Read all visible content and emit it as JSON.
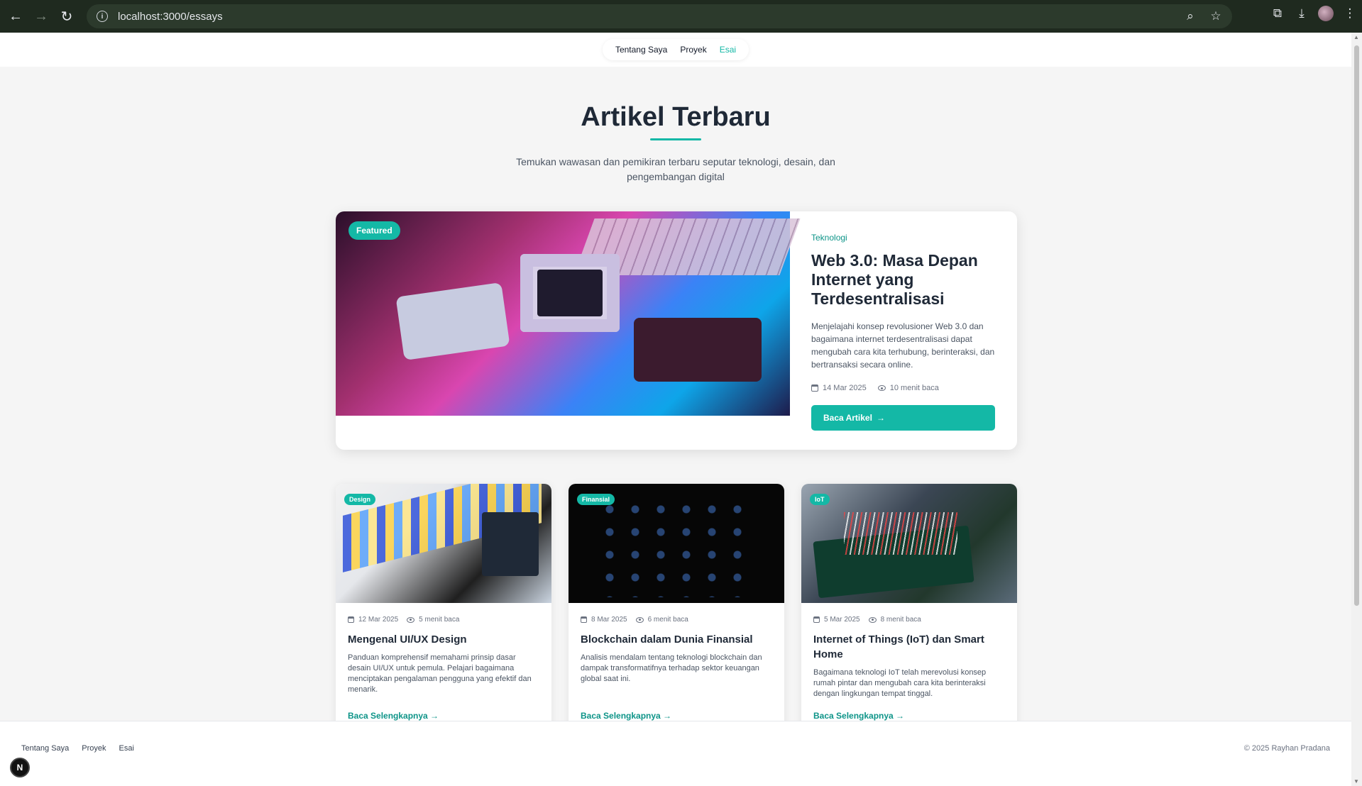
{
  "browser": {
    "url": "localhost:3000/essays"
  },
  "nav": {
    "items": [
      "Tentang Saya",
      "Proyek",
      "Esai"
    ],
    "active": "Esai"
  },
  "hero": {
    "title": "Artikel Terbaru",
    "subtitle": "Temukan wawasan dan pemikiran terbaru seputar teknologi, desain, dan pengembangan digital"
  },
  "featured": {
    "badge": "Featured",
    "category": "Teknologi",
    "title": "Web 3.0: Masa Depan Internet yang Terdesentralisasi",
    "description": "Menjelajahi konsep revolusioner Web 3.0 dan bagaimana internet terdesentralisasi dapat mengubah cara kita terhubung, berinteraksi, dan bertransaksi secara online.",
    "date": "14 Mar 2025",
    "read_time": "10 menit baca",
    "button": "Baca Artikel",
    "button_arrow": "→"
  },
  "cards": [
    {
      "tag": "Design",
      "date": "12 Mar 2025",
      "read_time": "5 menit baca",
      "title": "Mengenal UI/UX Design",
      "description": "Panduan komprehensif memahami prinsip dasar desain UI/UX untuk pemula. Pelajari bagaimana menciptakan pengalaman pengguna yang efektif dan menarik.",
      "link": "Baca Selengkapnya →"
    },
    {
      "tag": "Finansial",
      "date": "8 Mar 2025",
      "read_time": "6 menit baca",
      "title": "Blockchain dalam Dunia Finansial",
      "description": "Analisis mendalam tentang teknologi blockchain dan dampak transformatifnya terhadap sektor keuangan global saat ini.",
      "link": "Baca Selengkapnya →"
    },
    {
      "tag": "IoT",
      "date": "5 Mar 2025",
      "read_time": "8 menit baca",
      "title": "Internet of Things (IoT) dan Smart Home",
      "description": "Bagaimana teknologi IoT telah merevolusi konsep rumah pintar dan mengubah cara kita berinteraksi dengan lingkungan tempat tinggal.",
      "link": "Baca Selengkapnya →"
    }
  ],
  "footer": {
    "links": [
      "Tentang Saya",
      "Proyek",
      "Esai"
    ],
    "copyright": "© 2025 Rayhan Pradana"
  },
  "dev_badge": "N",
  "colors": {
    "accent": "#14b8a6",
    "accent_dark": "#0d9488"
  }
}
